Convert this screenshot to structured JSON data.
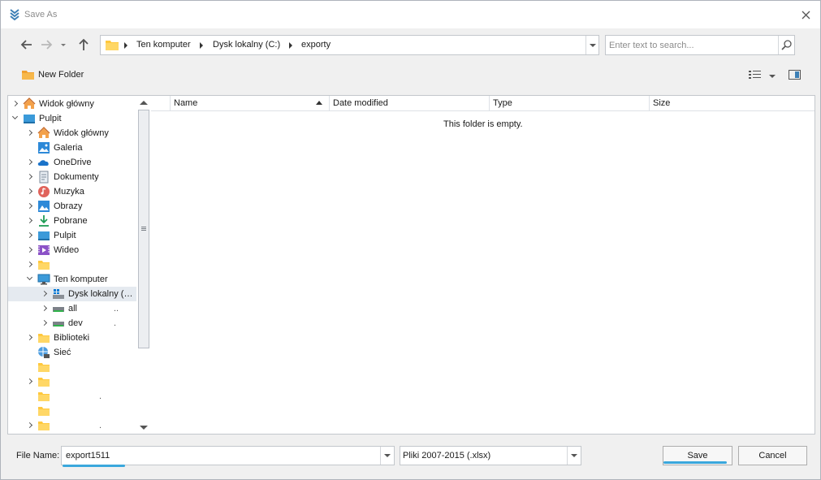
{
  "window": {
    "title": "Save As"
  },
  "nav": {
    "breadcrumbs": [
      "Ten komputer",
      "Dysk lokalny (C:)",
      "exporty"
    ]
  },
  "search": {
    "placeholder": "Enter text to search..."
  },
  "toolbar": {
    "new_folder_label": "New Folder"
  },
  "tree": {
    "items": [
      {
        "label": "Widok główny",
        "icon": "home-icon",
        "expander": "closed",
        "level": 0
      },
      {
        "label": "Pulpit",
        "icon": "desktop-icon",
        "expander": "open",
        "level": 0
      },
      {
        "label": "Widok główny",
        "icon": "home-icon",
        "expander": "closed",
        "level": 1
      },
      {
        "label": "Galeria",
        "icon": "gallery-icon",
        "expander": "none",
        "level": 1
      },
      {
        "label": "OneDrive",
        "icon": "onedrive-icon",
        "expander": "closed",
        "level": 1
      },
      {
        "label": "Dokumenty",
        "icon": "documents-icon",
        "expander": "closed",
        "level": 1
      },
      {
        "label": "Muzyka",
        "icon": "music-icon",
        "expander": "closed",
        "level": 1
      },
      {
        "label": "Obrazy",
        "icon": "pictures-icon",
        "expander": "closed",
        "level": 1
      },
      {
        "label": "Pobrane",
        "icon": "downloads-icon",
        "expander": "closed",
        "level": 1
      },
      {
        "label": "Pulpit",
        "icon": "desktop-icon",
        "expander": "closed",
        "level": 1
      },
      {
        "label": "Wideo",
        "icon": "video-icon",
        "expander": "closed",
        "level": 1
      },
      {
        "label": "",
        "icon": "folder-icon",
        "expander": "closed",
        "level": 1
      },
      {
        "label": "Ten komputer",
        "icon": "computer-icon",
        "expander": "open",
        "level": 1
      },
      {
        "label": "Dysk lokalny (…",
        "icon": "system-drive-icon",
        "expander": "closed",
        "level": 2,
        "selected": true
      },
      {
        "label": "all",
        "icon": "drive-icon",
        "expander": "closed",
        "level": 2,
        "extra": ".."
      },
      {
        "label": "dev",
        "icon": "drive-icon",
        "expander": "closed",
        "level": 2,
        "extra": "."
      },
      {
        "label": "Biblioteki",
        "icon": "folder-icon",
        "expander": "closed",
        "level": 1
      },
      {
        "label": "Sieć",
        "icon": "network-icon",
        "expander": "none",
        "level": 1
      },
      {
        "label": "",
        "icon": "folder-icon",
        "expander": "none",
        "level": 1
      },
      {
        "label": "",
        "icon": "folder-icon",
        "expander": "closed",
        "level": 1
      },
      {
        "label": "",
        "icon": "folder-icon",
        "expander": "none",
        "level": 1,
        "extra": "."
      },
      {
        "label": "",
        "icon": "folder-icon",
        "expander": "none",
        "level": 1
      },
      {
        "label": "",
        "icon": "folder-icon",
        "expander": "closed",
        "level": 1,
        "extra": "."
      }
    ]
  },
  "columns": [
    "Name",
    "Date modified",
    "Type",
    "Size"
  ],
  "file_list": {
    "empty_message": "This folder is empty."
  },
  "bottom": {
    "file_name_label": "File Name:",
    "file_name_value": "export1511",
    "file_type_value": "Pliki 2007-2015 (.xlsx)",
    "save_label": "Save",
    "cancel_label": "Cancel"
  },
  "colors": {
    "accent_underline": "#3aa7dc",
    "selection": "#e5eaf0",
    "folder": "#ffc83d"
  }
}
